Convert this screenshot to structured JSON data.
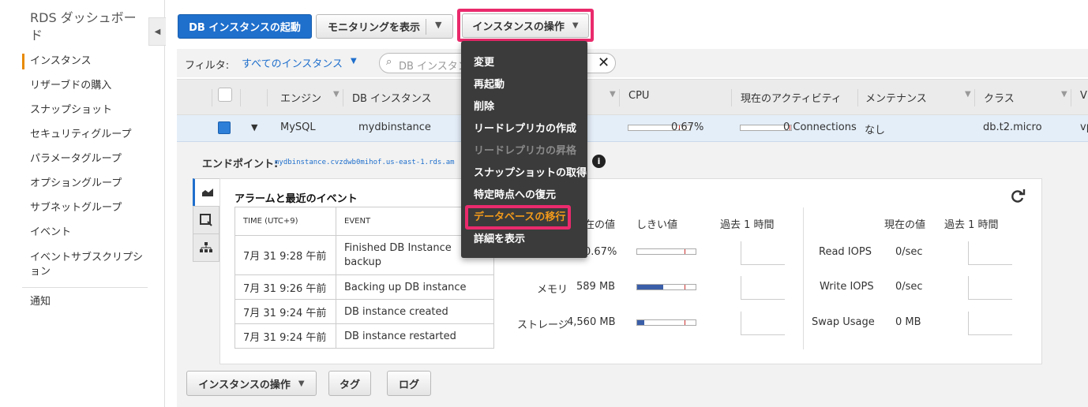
{
  "sidebar": {
    "title": "RDS ダッシュボード",
    "items": [
      {
        "label": "インスタンス"
      },
      {
        "label": "リザーブドの購入"
      },
      {
        "label": "スナップショット"
      },
      {
        "label": "セキュリティグループ"
      },
      {
        "label": "パラメータグループ"
      },
      {
        "label": "オプショングループ"
      },
      {
        "label": "サブネットグループ"
      },
      {
        "label": "イベント"
      },
      {
        "label": "イベントサブスクリプション"
      },
      {
        "label": "通知"
      }
    ],
    "collapse_icon": "◀"
  },
  "toolbar": {
    "launch_label": "DB インスタンスの起動",
    "monitoring_label": "モニタリングを表示",
    "instance_actions_label": "インスタンスの操作",
    "accent_color": "#1f6fcc",
    "highlight_color": "#ea2a6c"
  },
  "filter": {
    "label": "フィルタ:",
    "value": "すべてのインスタンス",
    "search_placeholder": "DB インスタンス"
  },
  "table": {
    "headers": [
      "エンジン",
      "DB インスタンス",
      "CPU",
      "現在のアクティビティ",
      "メンテナンス",
      "クラス",
      "V"
    ],
    "row": {
      "engine": "MySQL",
      "instance": "mydbinstance",
      "cpu": "0.67%",
      "cpu_fraction": 0.0067,
      "activity": "0 Connections",
      "maintenance": "なし",
      "class": "db.t2.micro",
      "v": "vp"
    }
  },
  "menu": {
    "items": [
      {
        "label": "変更",
        "state": "normal"
      },
      {
        "label": "再起動",
        "state": "normal"
      },
      {
        "label": "削除",
        "state": "normal"
      },
      {
        "label": "リードレプリカの作成",
        "state": "normal"
      },
      {
        "label": "リードレプリカの昇格",
        "state": "disabled"
      },
      {
        "label": "スナップショットの取得",
        "state": "normal"
      },
      {
        "label": "特定時点への復元",
        "state": "normal"
      },
      {
        "label": "データベースの移行",
        "state": "highlighted"
      },
      {
        "label": "詳細を表示",
        "state": "normal"
      }
    ]
  },
  "details": {
    "endpoint_label": "エンドポイント:",
    "endpoint_value": "mydbinstance.cvzdwb0mihof.us-east-1.rds.am",
    "panel_title": "アラームと最近のイベント",
    "events_headers": {
      "time": "TIME (UTC+9)",
      "event": "EVENT"
    },
    "events": [
      {
        "time": "7月 31 9:28 午前",
        "event": "Finished DB Instance backup"
      },
      {
        "time": "7月 31 9:26 午前",
        "event": "Backing up DB instance"
      },
      {
        "time": "7月 31 9:24 午前",
        "event": "DB instance created"
      },
      {
        "time": "7月 31 9:24 午前",
        "event": "DB instance restarted"
      }
    ],
    "metrics_headers": {
      "current": "在の値",
      "threshold": "しきい値",
      "past": "過去 1 時間"
    },
    "metrics": [
      {
        "name": "",
        "value": "0.67%",
        "fill": 0.0067
      },
      {
        "name": "メモリ",
        "value": "589 MB",
        "fill": 0.45
      },
      {
        "name": "ストレージ",
        "value": "4,560 MB",
        "fill": 0.12
      }
    ],
    "io_headers": {
      "current": "現在の値",
      "past": "過去 1 時間"
    },
    "io_metrics": [
      {
        "name": "Read IOPS",
        "value": "0/sec"
      },
      {
        "name": "Write IOPS",
        "value": "0/sec"
      },
      {
        "name": "Swap Usage",
        "value": "0 MB"
      }
    ]
  },
  "bottom": {
    "actions_label": "インスタンスの操作",
    "tags_label": "タグ",
    "logs_label": "ログ"
  }
}
